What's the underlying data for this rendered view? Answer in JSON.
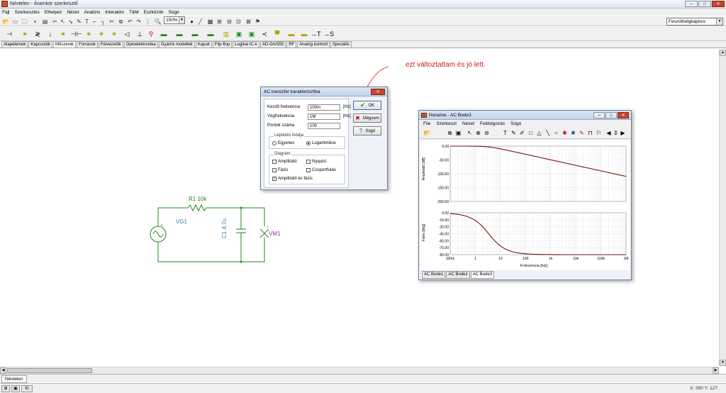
{
  "app": {
    "title": "Névtelen - Áramkör szerkesztő"
  },
  "menu": [
    "Fájl",
    "Szerkesztés",
    "Elhelyez",
    "Nézet",
    "Analízis",
    "Interaktív",
    "T&M",
    "Eszközök",
    "Súgó"
  ],
  "toolbar": {
    "zoom": "150%",
    "selector": "Feszültségkapocs"
  },
  "component_tabs": [
    "Alapelemek",
    "Kapcsolók",
    "Műszerek",
    "Források",
    "Félvezetők",
    "Optoelektronika",
    "Gyártói modellek",
    "Kapuk",
    "Flip-flop",
    "Logikai IC-k",
    "AD-DA/555",
    "RF",
    "Analóg kontroll",
    "Speciális"
  ],
  "annotation": "ezt változtattam és jó lett.",
  "circuit": {
    "r1": "R1 10k",
    "vg1": "VG1",
    "c1": "C1 4,7u",
    "vm1": "VM1"
  },
  "dialog": {
    "title": "AC transzfer karakterisztika",
    "start_label": "Kezdő frekvencia",
    "start_value": "100m",
    "start_unit": "[Hz]",
    "end_label": "Végfrekvencia",
    "end_value": "1M",
    "end_unit": "[Hz]",
    "points_label": "Pontok száma",
    "points_value": "100",
    "step_group": "Léptetés módja",
    "step_linear": "Egyenes",
    "step_log": "Logaritmikus",
    "diagram_group": "Diagram",
    "amp": "Amplitúdó",
    "nyquist": "Nyquist",
    "phase": "Fázis",
    "group_delay": "Csoportfutás",
    "amp_phase": "Amplitúdó és fázis",
    "ok": "OK",
    "cancel": "Mégsem",
    "help": "Súgó"
  },
  "bode": {
    "title": "Noname - AC Bode3",
    "menu": [
      "File",
      "Szerkeszt",
      "Nézet",
      "Feldolgozás",
      "Súgó"
    ],
    "amp_ylabel": "Amplitúdó [dB]",
    "phase_ylabel": "Fázis [deg]",
    "xlabel": "Frekvencia [Hz]",
    "amp_ticks": [
      "0.00",
      "-50.00",
      "-100.00",
      "-150.00",
      "-200.00"
    ],
    "phase_ticks": [
      "0.00",
      "-15.00",
      "-30.00",
      "-45.00",
      "-60.00",
      "-75.00",
      "-90.00"
    ],
    "x_ticks": [
      "100m",
      "1",
      "10",
      "100",
      "1k",
      "10k",
      "100k",
      "1M"
    ],
    "tabs": [
      "AC Bode1",
      "AC Bode2",
      "AC Bode3"
    ]
  },
  "doc_tab": "Névtelen",
  "status": {
    "coords": "X: 350  Y: 127"
  },
  "colors": {
    "curve": "#7a1414",
    "annotation": "#cc1b1b",
    "circuit": "#1c8a1c",
    "label_blue": "#3a7ab0",
    "label_purple": "#9a2a9a"
  }
}
